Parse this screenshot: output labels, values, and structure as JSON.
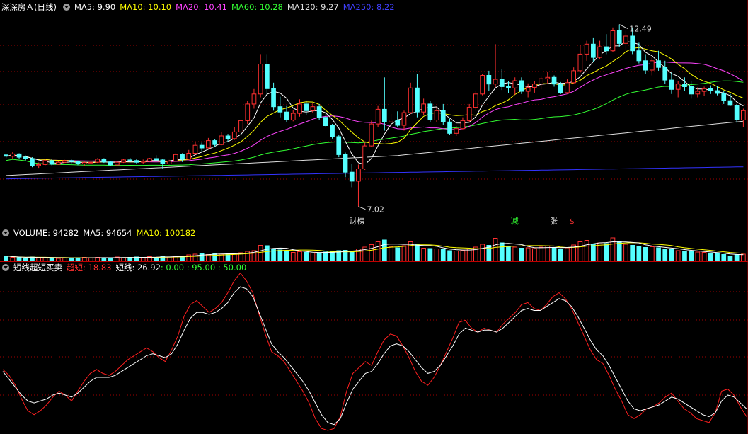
{
  "header": {
    "title": "深深房Ａ(日线)",
    "ma_labels": [
      {
        "label": "MA5: 9.90",
        "color": "#ffffff"
      },
      {
        "label": "MA10: 10.10",
        "color": "#ffff00"
      },
      {
        "label": "MA20: 10.41",
        "color": "#ff44ff"
      },
      {
        "label": "MA60: 10.28",
        "color": "#33ff33"
      },
      {
        "label": "MA120: 9.27",
        "color": "#dddddd"
      },
      {
        "label": "MA250: 8.22",
        "color": "#3333ff"
      }
    ]
  },
  "volume_header": {
    "label": "VOLUME: 94282",
    "ma5": "MA5: 94654",
    "ma10": "MA10: 100182"
  },
  "indicator_header": {
    "name": "短线超短买卖",
    "chaoduan": "超短: 18.83",
    "duanxian": "短线: 26.92",
    "levels": ": 0.00 : 95.00 : 50.00"
  },
  "annotations": {
    "high": "12.49",
    "low": "7.02",
    "markers": [
      {
        "text": "财榜",
        "color": "#dddddd"
      },
      {
        "text": "减",
        "color": "#33ff33"
      },
      {
        "text": "张",
        "color": "#dddddd"
      },
      {
        "text": "$",
        "color": "#ff3333"
      }
    ]
  },
  "colors": {
    "up": "#ff3030",
    "down": "#54ffff",
    "ma5": "#ffffff",
    "ma10": "#ffff00",
    "ma20": "#ff44ff",
    "ma60": "#33ff33",
    "ma120": "#dddddd",
    "ma250": "#3333ff",
    "chaoduan": "#ff2020",
    "duanxian": "#ffffff",
    "grid": "#a00000"
  },
  "chart_data": {
    "type": "candlestick",
    "price_range": [
      6.8,
      12.8
    ],
    "candles_ohlc": [
      [
        8.57,
        8.57,
        8.47,
        8.53
      ],
      [
        8.53,
        8.66,
        8.45,
        8.6
      ],
      [
        8.6,
        8.62,
        8.46,
        8.5
      ],
      [
        8.5,
        8.55,
        8.41,
        8.46
      ],
      [
        8.46,
        8.5,
        8.2,
        8.25
      ],
      [
        8.25,
        8.34,
        8.18,
        8.28
      ],
      [
        8.28,
        8.45,
        8.26,
        8.4
      ],
      [
        8.4,
        8.44,
        8.26,
        8.29
      ],
      [
        8.29,
        8.38,
        8.27,
        8.35
      ],
      [
        8.35,
        8.42,
        8.33,
        8.4
      ],
      [
        8.4,
        8.43,
        8.32,
        8.37
      ],
      [
        8.37,
        8.4,
        8.26,
        8.3
      ],
      [
        8.3,
        8.38,
        8.24,
        8.34
      ],
      [
        8.34,
        8.4,
        8.3,
        8.35
      ],
      [
        8.35,
        8.47,
        8.33,
        8.44
      ],
      [
        8.44,
        8.47,
        8.33,
        8.36
      ],
      [
        8.36,
        8.39,
        8.23,
        8.27
      ],
      [
        8.27,
        8.39,
        8.25,
        8.35
      ],
      [
        8.35,
        8.45,
        8.33,
        8.42
      ],
      [
        8.42,
        8.48,
        8.36,
        8.4
      ],
      [
        8.4,
        8.45,
        8.31,
        8.35
      ],
      [
        8.35,
        8.43,
        8.3,
        8.38
      ],
      [
        8.38,
        8.48,
        8.36,
        8.46
      ],
      [
        8.46,
        8.56,
        8.4,
        8.42
      ],
      [
        8.42,
        8.46,
        8.16,
        8.3
      ],
      [
        8.3,
        8.42,
        8.28,
        8.38
      ],
      [
        8.38,
        8.62,
        8.36,
        8.58
      ],
      [
        8.58,
        8.62,
        8.36,
        8.44
      ],
      [
        8.44,
        8.72,
        8.42,
        8.62
      ],
      [
        8.62,
        8.96,
        8.58,
        8.86
      ],
      [
        8.86,
        8.94,
        8.68,
        8.78
      ],
      [
        8.78,
        9.08,
        8.74,
        9.0
      ],
      [
        9.0,
        9.05,
        8.8,
        8.88
      ],
      [
        8.88,
        9.26,
        8.86,
        9.14
      ],
      [
        9.14,
        9.2,
        8.95,
        9.06
      ],
      [
        9.06,
        9.4,
        9.02,
        9.26
      ],
      [
        9.26,
        9.72,
        9.22,
        9.6
      ],
      [
        9.6,
        10.2,
        9.5,
        10.1
      ],
      [
        10.1,
        10.55,
        9.96,
        10.4
      ],
      [
        10.4,
        11.6,
        10.3,
        11.3
      ],
      [
        11.3,
        11.6,
        10.36,
        10.56
      ],
      [
        10.56,
        10.74,
        9.9,
        10.02
      ],
      [
        10.02,
        10.32,
        9.7,
        9.86
      ],
      [
        9.86,
        10.04,
        9.56,
        9.62
      ],
      [
        9.62,
        9.92,
        9.58,
        9.82
      ],
      [
        9.82,
        10.24,
        9.72,
        10.1
      ],
      [
        10.1,
        10.2,
        9.76,
        9.9
      ],
      [
        9.9,
        10.12,
        9.84,
        10.02
      ],
      [
        10.02,
        10.1,
        9.62,
        9.7
      ],
      [
        9.7,
        9.82,
        9.4,
        9.45
      ],
      [
        9.45,
        9.5,
        9.06,
        9.12
      ],
      [
        9.12,
        9.18,
        8.5,
        8.58
      ],
      [
        8.58,
        8.64,
        7.9,
        8.05
      ],
      [
        8.05,
        8.3,
        7.6,
        7.78
      ],
      [
        7.78,
        8.28,
        7.02,
        8.15
      ],
      [
        8.15,
        8.94,
        8.12,
        8.84
      ],
      [
        8.84,
        9.6,
        8.8,
        9.5
      ],
      [
        9.5,
        10.04,
        9.4,
        9.94
      ],
      [
        9.94,
        10.9,
        9.3,
        9.56
      ],
      [
        9.56,
        9.8,
        9.42,
        9.62
      ],
      [
        9.62,
        9.88,
        9.4,
        9.46
      ],
      [
        9.46,
        9.9,
        9.3,
        9.84
      ],
      [
        9.84,
        10.74,
        9.8,
        10.58
      ],
      [
        10.58,
        11.0,
        9.7,
        9.86
      ],
      [
        9.86,
        10.26,
        9.76,
        10.1
      ],
      [
        10.1,
        10.2,
        9.56,
        9.62
      ],
      [
        9.62,
        10.0,
        9.56,
        9.9
      ],
      [
        9.9,
        10.1,
        9.46,
        9.56
      ],
      [
        9.56,
        9.66,
        9.18,
        9.22
      ],
      [
        9.22,
        9.44,
        9.14,
        9.36
      ],
      [
        9.36,
        9.7,
        9.34,
        9.6
      ],
      [
        9.6,
        10.1,
        9.56,
        10.0
      ],
      [
        10.0,
        10.5,
        9.9,
        10.4
      ],
      [
        10.4,
        11.0,
        10.36,
        10.96
      ],
      [
        10.96,
        11.1,
        10.5,
        10.7
      ],
      [
        10.7,
        11.9,
        10.6,
        10.84
      ],
      [
        10.84,
        11.14,
        10.52,
        10.62
      ],
      [
        10.62,
        10.8,
        10.42,
        10.58
      ],
      [
        10.58,
        10.9,
        10.38,
        10.8
      ],
      [
        10.8,
        10.9,
        10.4,
        10.48
      ],
      [
        10.48,
        10.72,
        10.3,
        10.6
      ],
      [
        10.6,
        10.8,
        10.44,
        10.7
      ],
      [
        10.7,
        10.92,
        10.54,
        10.86
      ],
      [
        10.86,
        11.06,
        10.72,
        10.9
      ],
      [
        10.9,
        10.96,
        10.62,
        10.7
      ],
      [
        10.7,
        10.76,
        10.4,
        10.44
      ],
      [
        10.44,
        10.84,
        10.4,
        10.74
      ],
      [
        10.74,
        11.2,
        10.7,
        11.1
      ],
      [
        11.1,
        11.86,
        11.04,
        11.6
      ],
      [
        11.6,
        12.0,
        11.4,
        11.9
      ],
      [
        11.9,
        12.1,
        11.36,
        11.5
      ],
      [
        11.5,
        12.0,
        11.46,
        11.82
      ],
      [
        11.82,
        12.2,
        11.6,
        11.7
      ],
      [
        11.7,
        12.4,
        11.66,
        12.3
      ],
      [
        12.3,
        12.49,
        11.8,
        11.92
      ],
      [
        11.92,
        12.3,
        11.7,
        12.14
      ],
      [
        12.14,
        12.4,
        11.6,
        11.7
      ],
      [
        11.7,
        11.94,
        11.32,
        11.4
      ],
      [
        11.4,
        11.6,
        11.0,
        11.12
      ],
      [
        11.12,
        11.5,
        10.96,
        11.4
      ],
      [
        11.4,
        11.7,
        11.1,
        11.2
      ],
      [
        11.2,
        11.4,
        10.7,
        10.82
      ],
      [
        10.82,
        11.06,
        10.4,
        10.54
      ],
      [
        10.54,
        10.8,
        10.3,
        10.7
      ],
      [
        10.7,
        10.9,
        10.5,
        10.62
      ],
      [
        10.62,
        10.8,
        10.26,
        10.4
      ],
      [
        10.4,
        10.6,
        10.3,
        10.48
      ],
      [
        10.48,
        10.62,
        10.34,
        10.56
      ],
      [
        10.56,
        10.66,
        10.4,
        10.5
      ],
      [
        10.5,
        10.64,
        10.36,
        10.42
      ],
      [
        10.42,
        10.5,
        10.1,
        10.2
      ],
      [
        10.2,
        10.4,
        10.04,
        10.06
      ],
      [
        10.06,
        10.1,
        9.54,
        9.62
      ],
      [
        9.62,
        9.96,
        9.4,
        9.9
      ]
    ],
    "volume_values": [
      30,
      22,
      20,
      18,
      24,
      20,
      22,
      18,
      16,
      20,
      18,
      20,
      22,
      18,
      22,
      20,
      18,
      24,
      20,
      22,
      24,
      20,
      26,
      22,
      30,
      24,
      28,
      30,
      36,
      40,
      42,
      38,
      44,
      40,
      46,
      42,
      48,
      56,
      60,
      90,
      88,
      70,
      64,
      56,
      50,
      54,
      50,
      46,
      48,
      52,
      56,
      60,
      62,
      58,
      70,
      80,
      94,
      110,
      120,
      84,
      76,
      88,
      110,
      96,
      74,
      72,
      70,
      68,
      60,
      58,
      62,
      70,
      80,
      96,
      90,
      130,
      104,
      84,
      80,
      74,
      76,
      72,
      80,
      86,
      78,
      70,
      76,
      92,
      110,
      118,
      96,
      104,
      100,
      132,
      114,
      96,
      90,
      86,
      78,
      82,
      76,
      70,
      66,
      60,
      58,
      56,
      52,
      50,
      46,
      42,
      38,
      30,
      36,
      40
    ],
    "chaoduan_values": [
      62,
      56,
      46,
      32,
      20,
      16,
      20,
      26,
      34,
      40,
      36,
      30,
      40,
      50,
      58,
      62,
      58,
      56,
      60,
      66,
      72,
      76,
      80,
      84,
      80,
      74,
      70,
      82,
      96,
      116,
      128,
      132,
      126,
      120,
      124,
      130,
      140,
      152,
      160,
      152,
      140,
      118,
      98,
      80,
      76,
      70,
      60,
      50,
      40,
      28,
      12,
      2,
      0,
      2,
      14,
      40,
      58,
      64,
      70,
      66,
      80,
      92,
      98,
      96,
      86,
      74,
      60,
      50,
      46,
      54,
      66,
      80,
      94,
      110,
      112,
      104,
      100,
      104,
      102,
      100,
      108,
      114,
      120,
      128,
      130,
      124,
      122,
      128,
      136,
      140,
      134,
      124,
      110,
      96,
      82,
      72,
      68,
      56,
      42,
      30,
      16,
      12,
      16,
      22,
      24,
      28,
      34,
      38,
      30,
      22,
      18,
      12,
      10,
      8,
      18,
      40,
      42,
      36,
      24,
      14
    ],
    "duanxian_values": [
      60,
      52,
      44,
      36,
      30,
      28,
      30,
      32,
      36,
      38,
      36,
      34,
      38,
      44,
      50,
      54,
      54,
      54,
      56,
      60,
      64,
      68,
      72,
      76,
      78,
      76,
      74,
      78,
      88,
      102,
      114,
      120,
      120,
      118,
      120,
      124,
      130,
      140,
      146,
      144,
      136,
      120,
      104,
      88,
      80,
      74,
      66,
      58,
      50,
      40,
      28,
      16,
      8,
      6,
      12,
      28,
      42,
      50,
      58,
      60,
      68,
      78,
      86,
      88,
      86,
      80,
      72,
      64,
      58,
      60,
      66,
      76,
      86,
      98,
      104,
      102,
      100,
      102,
      102,
      100,
      104,
      110,
      116,
      122,
      124,
      122,
      122,
      126,
      130,
      134,
      132,
      126,
      116,
      104,
      92,
      82,
      76,
      66,
      54,
      42,
      30,
      22,
      20,
      22,
      24,
      26,
      30,
      34,
      32,
      28,
      24,
      20,
      16,
      14,
      18,
      30,
      36,
      34,
      28,
      22
    ],
    "indicator_range": [
      0,
      95
    ]
  }
}
